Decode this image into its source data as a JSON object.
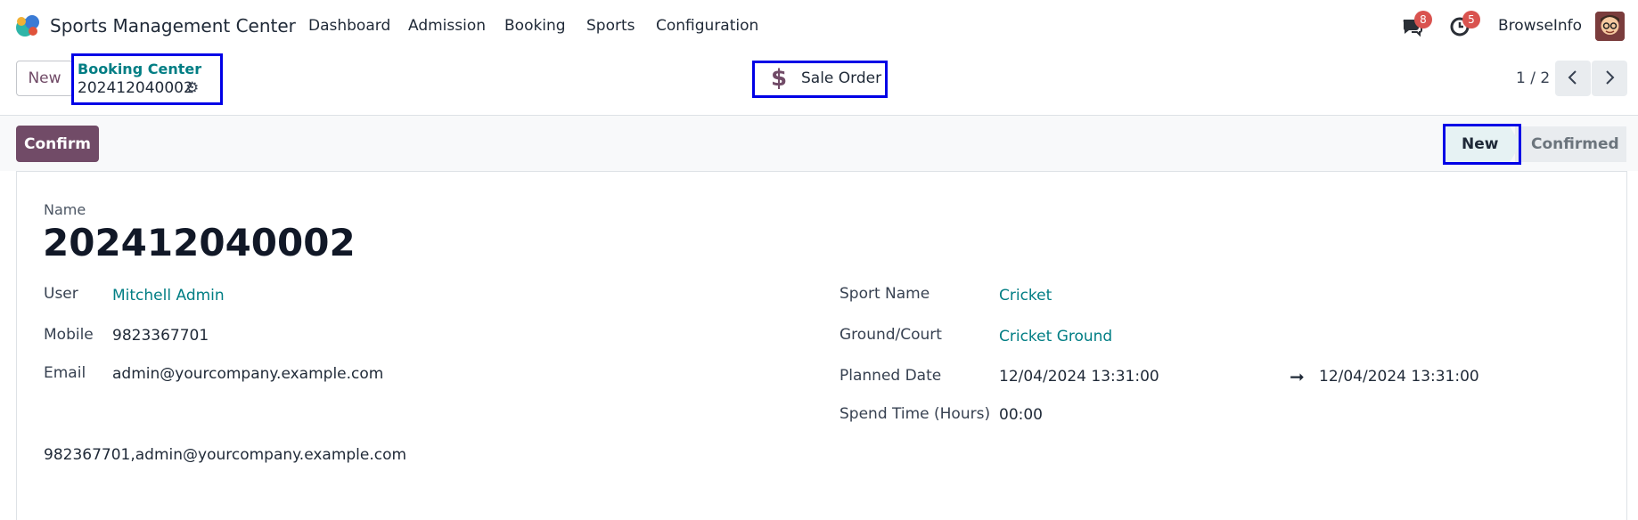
{
  "navbar": {
    "app_name": "Sports Management Center",
    "menu": [
      "Dashboard",
      "Admission",
      "Booking",
      "Sports",
      "Configuration"
    ],
    "messages_badge": "8",
    "activities_badge": "5",
    "company": "BrowseInfo"
  },
  "control_panel": {
    "new_label": "New",
    "breadcrumb_parent": "Booking Center",
    "breadcrumb_current": "202412040002",
    "smart_button_label": "Sale Order",
    "pager_value": "1 / 2"
  },
  "statusbar": {
    "confirm_label": "Confirm",
    "stages": [
      "New",
      "Confirmed"
    ],
    "active_stage": "New"
  },
  "form": {
    "name_label": "Name",
    "name_value": "202412040002",
    "user_label": "User",
    "user_value": "Mitchell Admin",
    "mobile_label": "Mobile",
    "mobile_value": "9823367701",
    "email_label": "Email",
    "email_value": "admin@yourcompany.example.com",
    "contact_line": "982367701,admin@yourcompany.example.com",
    "sport_label": "Sport Name",
    "sport_value": "Cricket",
    "ground_label": "Ground/Court",
    "ground_value": "Cricket Ground",
    "planned_label": "Planned Date",
    "planned_start": "12/04/2024 13:31:00",
    "planned_end": "12/04/2024 13:31:00",
    "spend_label": "Spend Time (Hours)",
    "spend_value": "00:00"
  },
  "colors": {
    "primary": "#714B67",
    "link": "#017e84",
    "highlight_box": "#0000e6",
    "badge": "#d9534f"
  }
}
